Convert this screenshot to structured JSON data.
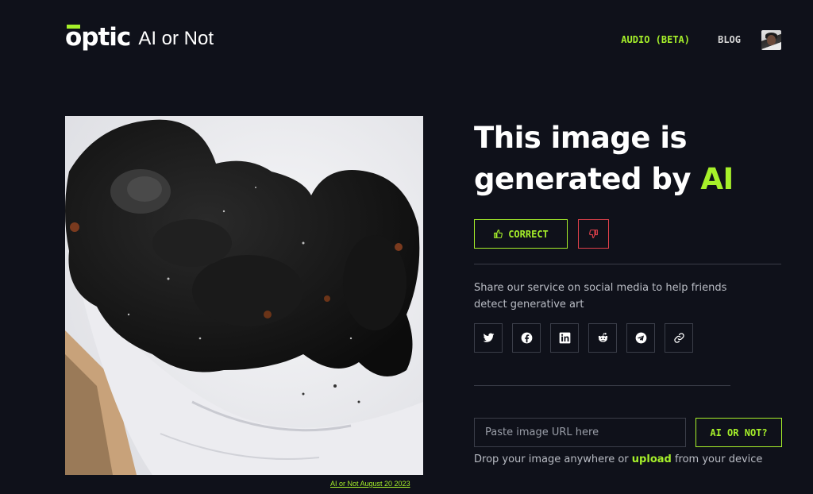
{
  "header": {
    "logo_text": "optic",
    "logo_subtitle": "AI or Not",
    "nav": [
      {
        "label": "AUDIO (BETA)",
        "icon": "none",
        "active": true
      },
      {
        "label": "BLOG",
        "icon": "none",
        "active": false
      }
    ],
    "avatar_icon": "user-avatar"
  },
  "result": {
    "image_caption": "AI or Not August 20 2023",
    "headline_prefix": "This image is generated by ",
    "headline_highlight": "AI",
    "correct_label": "CORRECT",
    "correct_icon": "thumbs-up-icon",
    "wrong_icon": "thumbs-down-icon"
  },
  "share": {
    "text": "Share our service on social media to help friends detect generative art",
    "networks": [
      "twitter-icon",
      "facebook-icon",
      "linkedin-icon",
      "reddit-icon",
      "telegram-icon",
      "link-icon"
    ]
  },
  "check": {
    "placeholder": "Paste image URL here",
    "button_label": "AI OR NOT?",
    "drop_prefix": "Drop your image anywhere or ",
    "drop_link": "upload",
    "drop_suffix": " from your device"
  },
  "colors": {
    "background": "#0f111a",
    "accent": "#a6f02a",
    "danger": "#e0414b"
  }
}
